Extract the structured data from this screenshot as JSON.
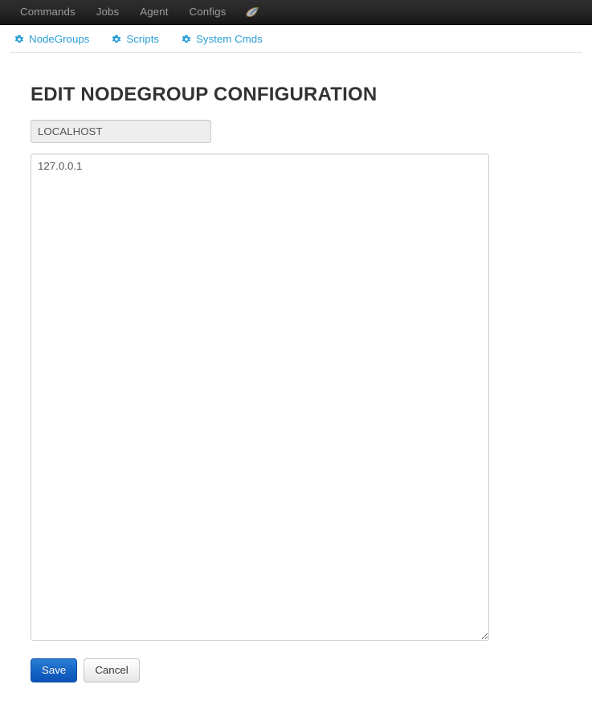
{
  "navbar": {
    "items": [
      {
        "label": "Commands"
      },
      {
        "label": "Jobs"
      },
      {
        "label": "Agent"
      },
      {
        "label": "Configs"
      }
    ],
    "brand_icon": "leaf-icon",
    "background_color": "#222222",
    "text_color": "#9d9d9d"
  },
  "subnav": {
    "accent_color": "#2a9fd6",
    "items": [
      {
        "label": "NodeGroups",
        "icon": "gear-icon"
      },
      {
        "label": "Scripts",
        "icon": "gear-icon"
      },
      {
        "label": "System Cmds",
        "icon": "gear-icon"
      }
    ]
  },
  "main": {
    "title": "EDIT NODEGROUP CONFIGURATION",
    "nodegroup_name": {
      "value": "LOCALHOST",
      "placeholder": "Nodegroup name",
      "readonly": true,
      "background_color": "#eeeeee"
    },
    "nodes_textarea": {
      "value": "127.0.0.1",
      "placeholder": "",
      "resize_handle": true
    },
    "buttons": {
      "save_label": "Save",
      "cancel_label": "Cancel",
      "save_color": "#1565c7"
    }
  }
}
